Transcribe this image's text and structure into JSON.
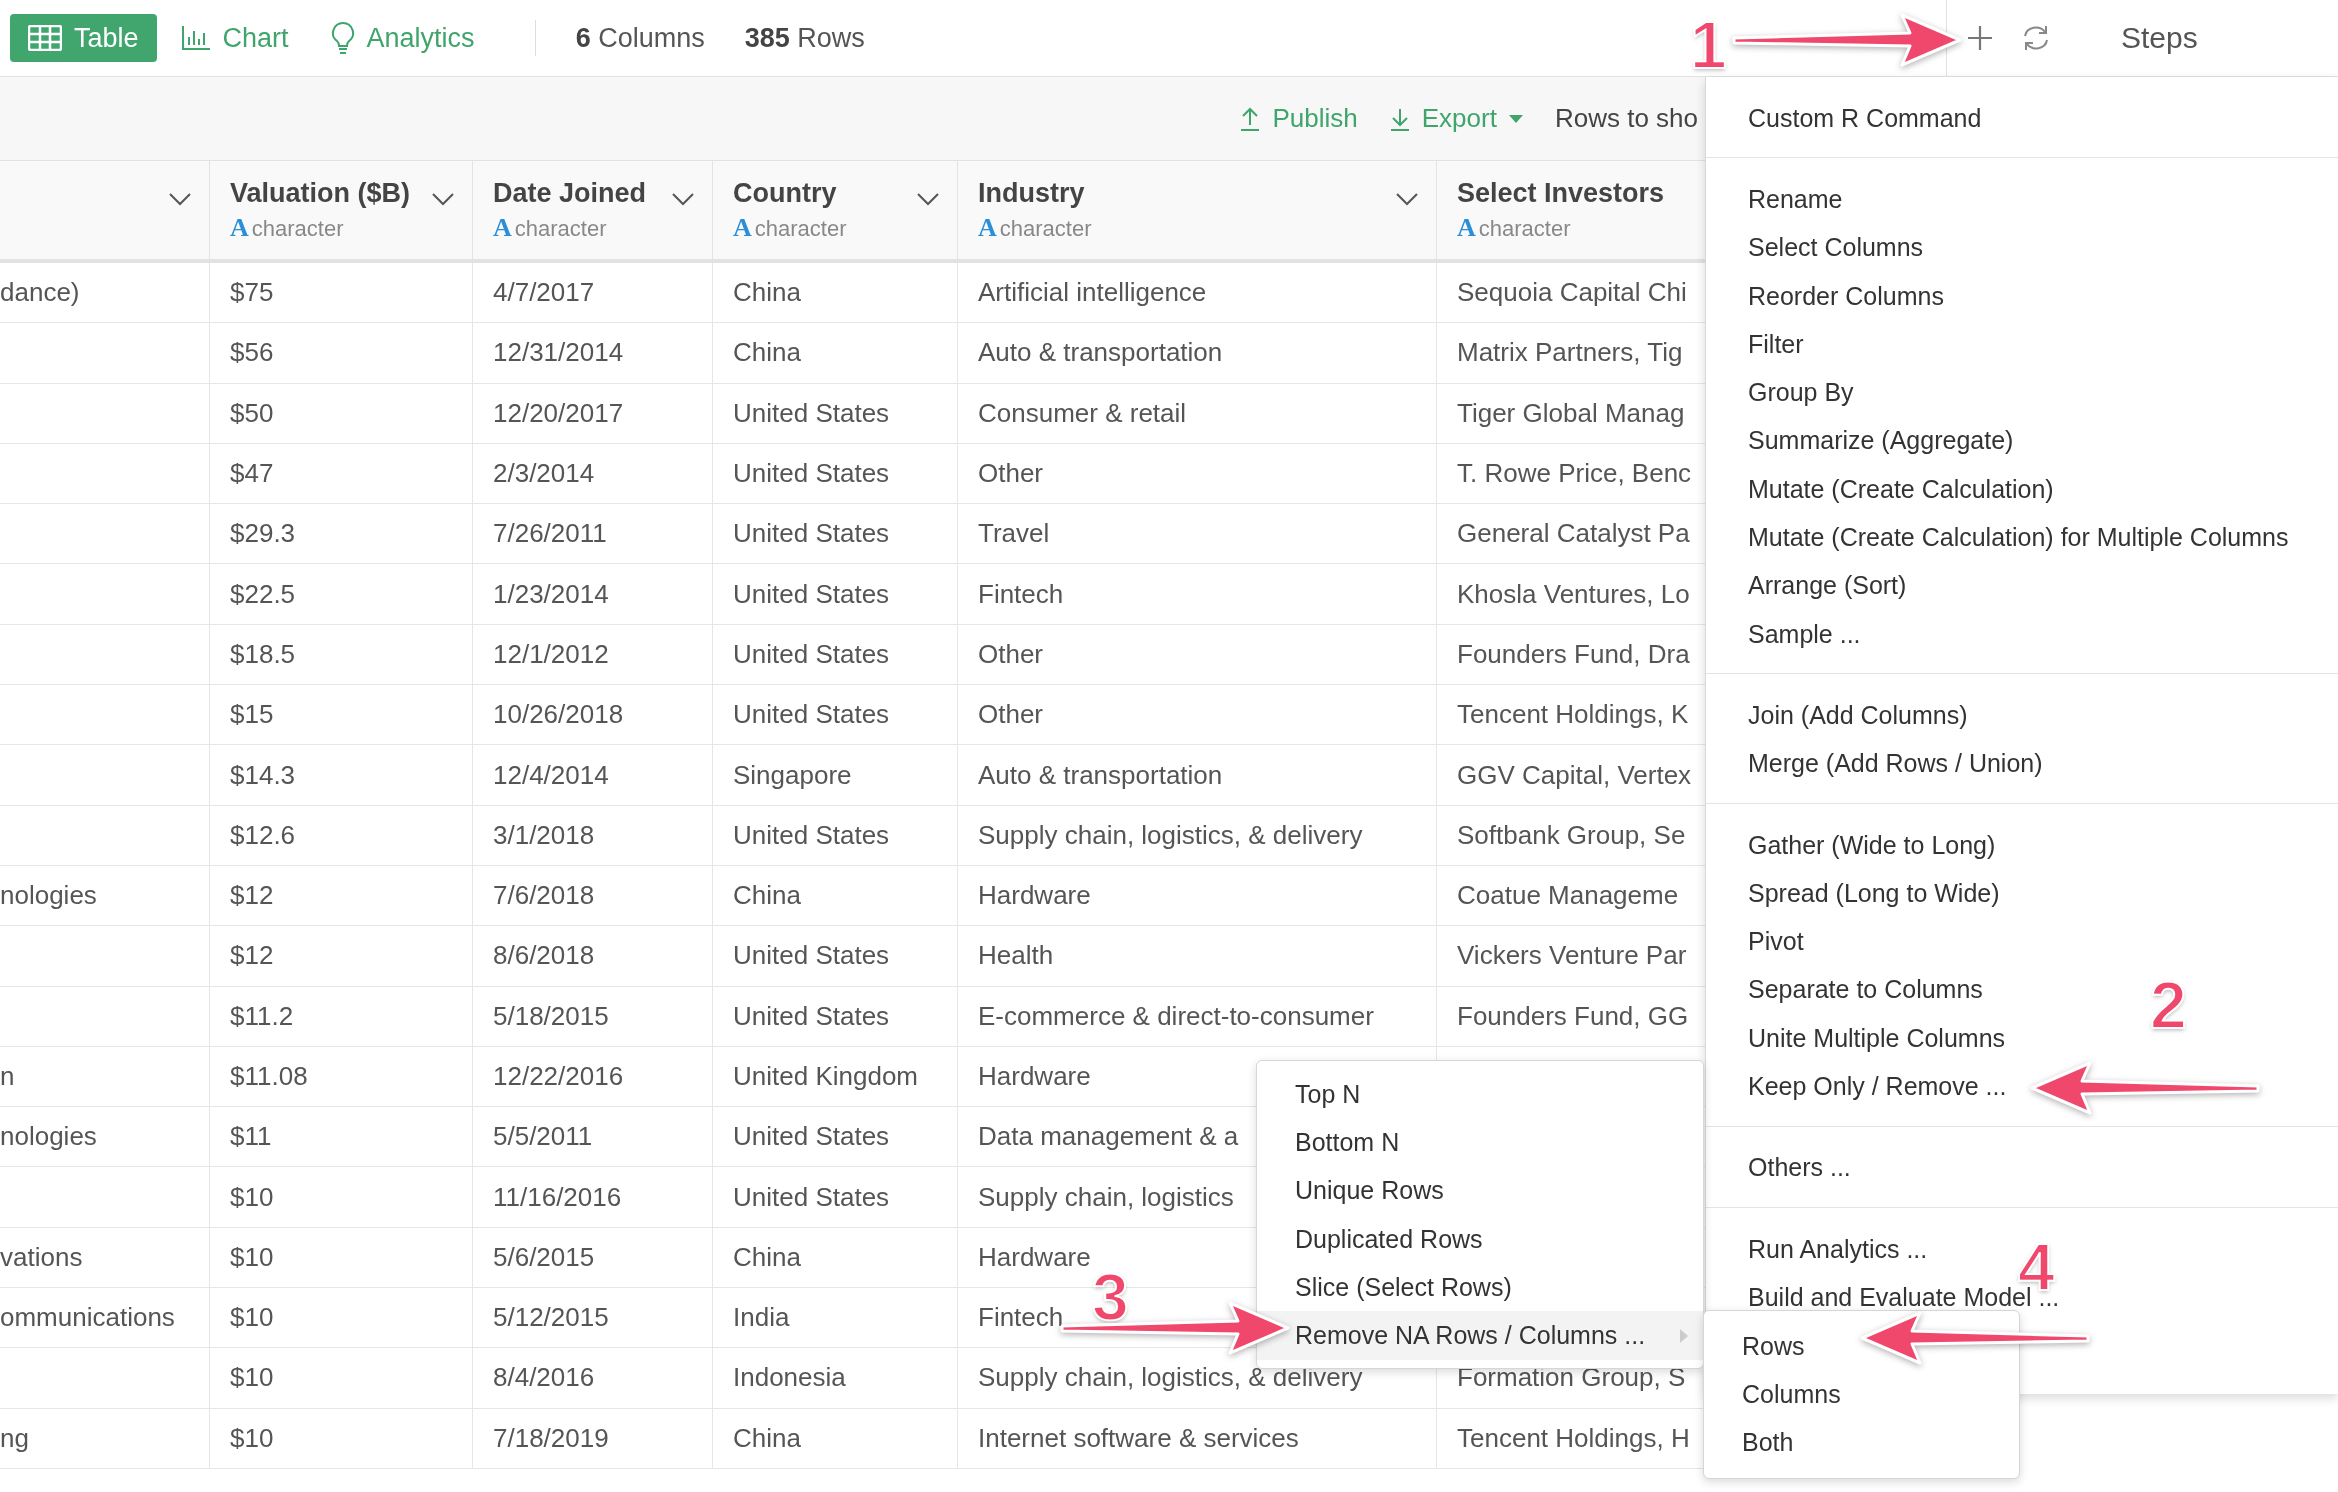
{
  "view_tabs": [
    {
      "label": "Table",
      "selected": true
    },
    {
      "label": "Chart",
      "selected": false
    },
    {
      "label": "Analytics",
      "selected": false
    }
  ],
  "summary": [
    "**6** Columns",
    "**385** Rows"
  ],
  "steps_header": {
    "title": "Steps"
  },
  "toolbar": {
    "publish": "Publish",
    "export": "Export",
    "rows_to_show": "Rows to sho"
  },
  "table": {
    "columns": [
      {
        "label": "Valuation ($B)",
        "type_glyph": "A",
        "type": "character"
      },
      {
        "label": "Date Joined",
        "type_glyph": "A",
        "type": "character"
      },
      {
        "label": "Country",
        "type_glyph": "A",
        "type": "character"
      },
      {
        "label": "Industry",
        "type_glyph": "A",
        "type": "character"
      },
      {
        "label": "Select Investors",
        "type_glyph": "A",
        "type": "character"
      }
    ],
    "rows": [
      {
        "column_1": "dance)",
        "cells": [
          "$75",
          "4/7/2017",
          "China",
          "Artificial intelligence",
          "Sequoia Capital Chi"
        ]
      },
      {
        "cells": [
          "$56",
          "12/31/2014",
          "China",
          "Auto & transportation",
          "Matrix Partners, Tig"
        ]
      },
      {
        "cells": [
          "$50",
          "12/20/2017",
          "United States",
          "Consumer & retail",
          "Tiger Global Manag"
        ]
      },
      {
        "cells": [
          "$47",
          "2/3/2014",
          "United States",
          "Other",
          "T. Rowe Price, Benc"
        ]
      },
      {
        "cells": [
          "$29.3",
          "7/26/2011",
          "United States",
          "Travel",
          "General Catalyst Pa"
        ]
      },
      {
        "cells": [
          "$22.5",
          "1/23/2014",
          "United States",
          "Fintech",
          "Khosla Ventures, Lo"
        ]
      },
      {
        "cells": [
          "$18.5",
          "12/1/2012",
          "United States",
          "Other",
          "Founders Fund, Dra"
        ]
      },
      {
        "cells": [
          "$15",
          "10/26/2018",
          "United States",
          "Other",
          "Tencent Holdings, K"
        ]
      },
      {
        "cells": [
          "$14.3",
          "12/4/2014",
          "Singapore",
          "Auto & transportation",
          "GGV Capital, Vertex"
        ]
      },
      {
        "cells": [
          "$12.6",
          "3/1/2018",
          "United States",
          "Supply chain, logistics, & delivery",
          "Softbank Group, Se"
        ]
      },
      {
        "column_1": "nologies",
        "cells": [
          "$12",
          "7/6/2018",
          "China",
          "Hardware",
          "Coatue Manageme"
        ]
      },
      {
        "cells": [
          "$12",
          "8/6/2018",
          "United States",
          "Health",
          "Vickers Venture Par"
        ]
      },
      {
        "cells": [
          "$11.2",
          "5/18/2015",
          "United States",
          "E-commerce & direct-to-consumer",
          "Founders Fund, GG"
        ]
      },
      {
        "column_1": "n",
        "cells": [
          "$11.08",
          "12/22/2016",
          "United Kingdom",
          "Hardware"
        ]
      },
      {
        "column_1": "nologies",
        "cells": [
          "$11",
          "5/5/2011",
          "United States",
          "Data management & a"
        ]
      },
      {
        "cells": [
          "$10",
          "11/16/2016",
          "United States",
          "Supply chain, logistics"
        ]
      },
      {
        "column_1": "vations",
        "cells": [
          "$10",
          "5/6/2015",
          "China",
          "Hardware"
        ]
      },
      {
        "column_1": "ommunications",
        "cells": [
          "$10",
          "5/12/2015",
          "India",
          "Fintech"
        ]
      },
      {
        "cells": [
          "$10",
          "8/4/2016",
          "Indonesia",
          "Supply chain, logistics, & delivery",
          "Formation Group, S"
        ]
      },
      {
        "column_1": "ng",
        "cells": [
          "$10",
          "7/18/2019",
          "China",
          "Internet software & services",
          "Tencent Holdings, H"
        ]
      }
    ]
  },
  "steps_menu": {
    "groups": [
      [
        "Custom R Command"
      ],
      [
        "Rename",
        "Select Columns",
        "Reorder Columns",
        "Filter",
        "Group By",
        "Summarize (Aggregate)",
        "Mutate (Create Calculation)",
        "Mutate (Create Calculation) for Multiple Columns",
        "Arrange (Sort)",
        "Sample ..."
      ],
      [
        "Join (Add Columns)",
        "Merge (Add Rows / Union)"
      ],
      [
        "Gather (Wide to Long)",
        "Spread (Long to Wide)",
        "Pivot",
        "Separate to Columns",
        "Unite Multiple Columns",
        "Keep Only / Remove ..."
      ],
      [
        "Others ..."
      ],
      [
        "Run Analytics ...",
        "Build and Evaluate Model ..."
      ]
    ]
  },
  "keep_only_menu": {
    "items": [
      {
        "label": "Top N",
        "selected": false,
        "has_submenu": false
      },
      {
        "label": "Bottom N",
        "selected": false,
        "has_submenu": false
      },
      {
        "label": "Unique Rows",
        "selected": false,
        "has_submenu": false
      },
      {
        "label": "Duplicated Rows",
        "selected": false,
        "has_submenu": false
      },
      {
        "label": "Slice (Select Rows)",
        "selected": false,
        "has_submenu": false
      },
      {
        "label": "Remove NA Rows / Columns ...",
        "selected": true,
        "has_submenu": true
      }
    ]
  },
  "remove_na_menu": {
    "items": [
      "Rows",
      "Columns",
      "Both"
    ]
  },
  "annotations": [
    {
      "label": "1"
    },
    {
      "label": "2"
    },
    {
      "label": "3"
    },
    {
      "label": "4"
    }
  ]
}
